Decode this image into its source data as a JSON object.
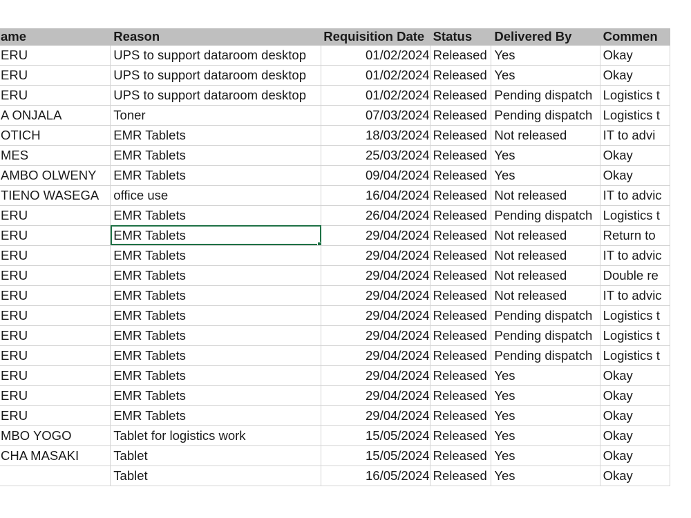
{
  "headers": {
    "name": "ame",
    "reason": "Reason",
    "date": "Requisition Date",
    "status": "Status",
    "delivered": "Delivered By",
    "comment": "Commen"
  },
  "rows": [
    {
      "name": "ERU",
      "reason": "UPS to support dataroom desktop",
      "date": "01/02/2024",
      "status": "Released",
      "delivered": "Yes",
      "comment": "Okay"
    },
    {
      "name": "ERU",
      "reason": "UPS to support dataroom desktop",
      "date": "01/02/2024",
      "status": "Released",
      "delivered": "Yes",
      "comment": "Okay"
    },
    {
      "name": "ERU",
      "reason": "UPS to support dataroom desktop",
      "date": "01/02/2024",
      "status": "Released",
      "delivered": "Pending dispatch",
      "comment": "Logistics t"
    },
    {
      "name": "A  ONJALA",
      "reason": "Toner",
      "date": "07/03/2024",
      "status": "Released",
      "delivered": "Pending dispatch",
      "comment": "Logistics t"
    },
    {
      "name": "OTICH",
      "reason": "EMR Tablets",
      "date": "18/03/2024",
      "status": "Released",
      "delivered": "Not released",
      "comment": "IT to advi"
    },
    {
      "name": "MES",
      "reason": "EMR Tablets",
      "date": "25/03/2024",
      "status": "Released",
      "delivered": "Yes",
      "comment": "Okay"
    },
    {
      "name": "AMBO OLWENY",
      "reason": "EMR Tablets",
      "date": "09/04/2024",
      "status": "Released",
      "delivered": "Yes",
      "comment": "Okay"
    },
    {
      "name": "TIENO WASEGA",
      "reason": "office use",
      "date": "16/04/2024",
      "status": "Released",
      "delivered": "Not released",
      "comment": "IT to advic"
    },
    {
      "name": "ERU",
      "reason": "EMR Tablets",
      "date": "26/04/2024",
      "status": "Released",
      "delivered": "Pending dispatch",
      "comment": "Logistics t"
    },
    {
      "name": "ERU",
      "reason": "EMR Tablets",
      "date": "29/04/2024",
      "status": "Released",
      "delivered": "Not released",
      "comment": "Return to"
    },
    {
      "name": "ERU",
      "reason": "EMR Tablets",
      "date": "29/04/2024",
      "status": "Released",
      "delivered": "Not released",
      "comment": "IT to advic"
    },
    {
      "name": "ERU",
      "reason": "EMR Tablets",
      "date": "29/04/2024",
      "status": "Released",
      "delivered": "Not released",
      "comment": "Double re"
    },
    {
      "name": "ERU",
      "reason": "EMR Tablets",
      "date": "29/04/2024",
      "status": "Released",
      "delivered": "Not released",
      "comment": "IT to advic"
    },
    {
      "name": "ERU",
      "reason": "EMR Tablets",
      "date": "29/04/2024",
      "status": "Released",
      "delivered": "Pending dispatch",
      "comment": "Logistics t"
    },
    {
      "name": "ERU",
      "reason": "EMR Tablets",
      "date": "29/04/2024",
      "status": "Released",
      "delivered": "Pending dispatch",
      "comment": "Logistics t"
    },
    {
      "name": "ERU",
      "reason": "EMR Tablets",
      "date": "29/04/2024",
      "status": "Released",
      "delivered": "Pending dispatch",
      "comment": "Logistics t"
    },
    {
      "name": "ERU",
      "reason": "EMR Tablets",
      "date": "29/04/2024",
      "status": "Released",
      "delivered": "Yes",
      "comment": "Okay"
    },
    {
      "name": "ERU",
      "reason": "EMR Tablets",
      "date": "29/04/2024",
      "status": "Released",
      "delivered": "Yes",
      "comment": "Okay"
    },
    {
      "name": "ERU",
      "reason": "EMR Tablets",
      "date": "29/04/2024",
      "status": "Released",
      "delivered": "Yes",
      "comment": "Okay"
    },
    {
      "name": "MBO YOGO",
      "reason": "Tablet for logistics work",
      "date": "15/05/2024",
      "status": "Released",
      "delivered": "Yes",
      "comment": "Okay"
    },
    {
      "name": "CHA MASAKI",
      "reason": "Tablet",
      "date": "15/05/2024",
      "status": "Released",
      "delivered": "Yes",
      "comment": "Okay"
    },
    {
      "name": "",
      "reason": "Tablet",
      "date": "16/05/2024",
      "status": "Released",
      "delivered": "Yes",
      "comment": "Okay"
    }
  ],
  "selected_cell": {
    "row": 9,
    "column": "reason"
  },
  "colors": {
    "header_bg": "#bfbfbf",
    "gridline": "#d4d4d4",
    "selection": "#1e7145"
  }
}
